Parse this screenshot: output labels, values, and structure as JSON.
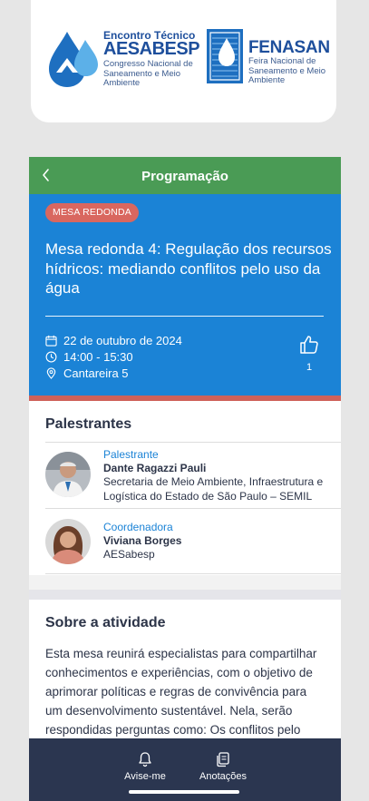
{
  "logos": {
    "aesabesp": {
      "title_small": "Encontro Técnico",
      "title_large": "AESABESP",
      "subtitle": "Congresso Nacional de Saneamento e Meio Ambiente"
    },
    "fenasan": {
      "title": "FENASAN",
      "subtitle": "Feira Nacional de Saneamento e Meio Ambiente"
    }
  },
  "header": {
    "title": "Programação",
    "back_icon": "chevron-left-icon"
  },
  "session": {
    "badge": "MESA REDONDA",
    "title": "Mesa redonda 4: Regulação dos recursos hídricos: mediando conflitos pelo uso da água",
    "date": "22 de outubro de 2024",
    "time": "14:00 - 15:30",
    "location": "Cantareira 5",
    "likes": "1"
  },
  "speakers": {
    "title": "Palestrantes",
    "items": [
      {
        "role": "Palestrante",
        "name": "Dante Ragazzi Pauli",
        "description": "Secretaria de Meio Ambiente, Infraestrutura e Logística do Estado de São Paulo – SEMIL"
      },
      {
        "role": "Coordenadora",
        "name": "Viviana Borges",
        "description": "AESabesp"
      }
    ]
  },
  "about": {
    "title": "Sobre a atividade",
    "text": "Esta mesa reunirá especialistas para compartilhar conhecimentos e experiências, com o objetivo de aprimorar políticas e regras de convivência para um desenvolvimento sustentável. Nela, serão respondidas perguntas como: Os conflitos pelo"
  },
  "bottom_nav": {
    "items": [
      {
        "label": "Avise-me",
        "icon": "bell-icon"
      },
      {
        "label": "Anotações",
        "icon": "notes-icon"
      }
    ]
  },
  "colors": {
    "header_green": "#4a9b55",
    "hero_blue": "#1b83d6",
    "badge_red": "#d9675f",
    "nav_navy": "#2b3650"
  }
}
